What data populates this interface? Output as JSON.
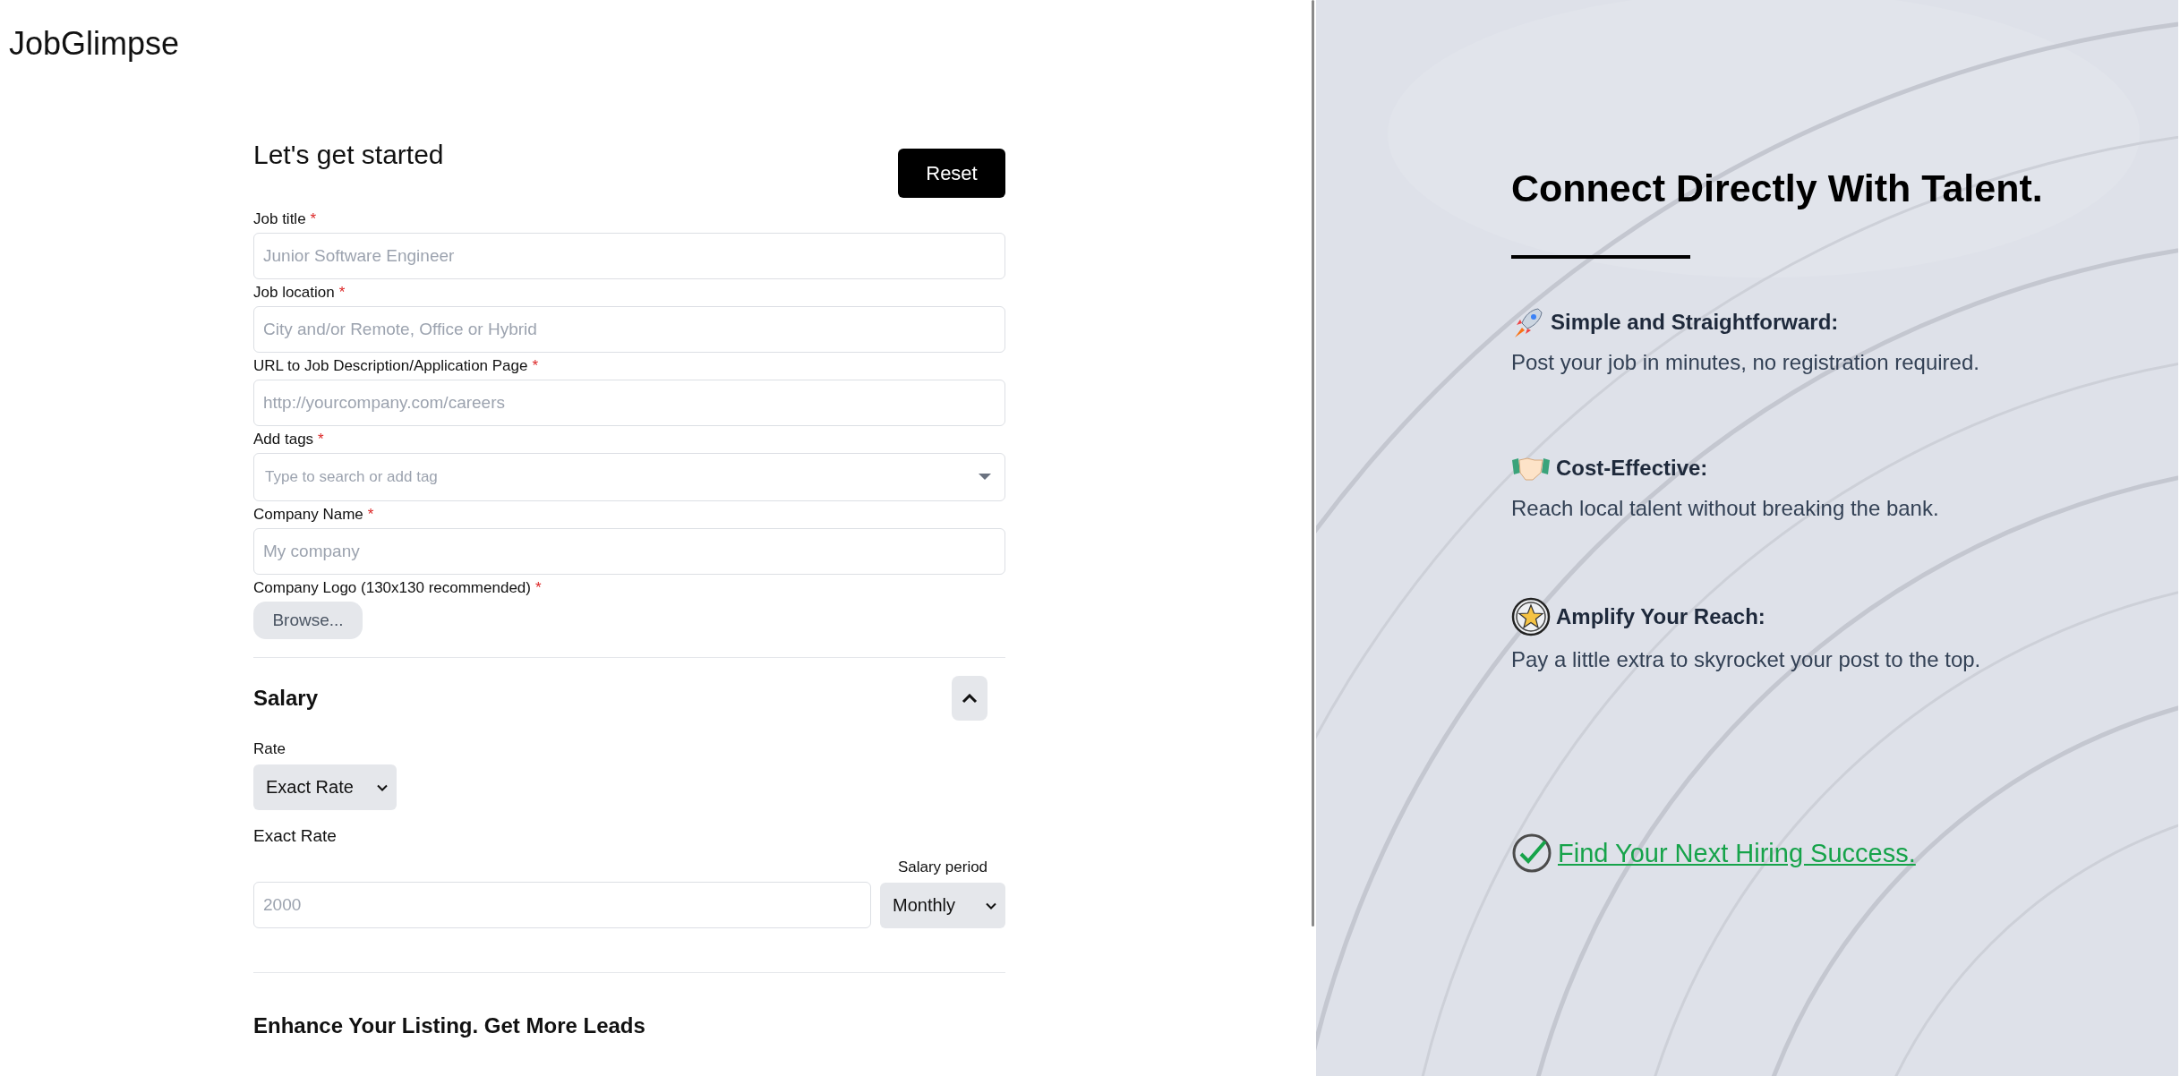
{
  "logo": "JobGlimpse",
  "form": {
    "heading": "Let's get started",
    "reset_button": "Reset",
    "required_mark": "*",
    "fields": [
      {
        "kind": "text",
        "label": "Job title",
        "required": true,
        "placeholder": "Junior Software Engineer"
      },
      {
        "kind": "text",
        "label": "Job location",
        "required": true,
        "placeholder": "City and/or Remote, Office or Hybrid"
      },
      {
        "kind": "text",
        "label": "URL to Job Description/Application Page",
        "required": true,
        "placeholder": "http://yourcompany.com/careers"
      },
      {
        "kind": "tags",
        "label": "Add tags",
        "required": true,
        "placeholder": "Type to search or add tag"
      },
      {
        "kind": "text",
        "label": "Company Name",
        "required": true,
        "placeholder": "My company"
      },
      {
        "kind": "file",
        "label": "Company Logo (130x130 recommended)",
        "required": true,
        "button": "Browse..."
      }
    ],
    "salary": {
      "title": "Salary",
      "expanded": true,
      "rate_label": "Rate",
      "rate_value": "Exact Rate",
      "exact_rate_label": "Exact Rate",
      "amount_placeholder": "2000",
      "period_label": "Salary period",
      "period_value": "Monthly"
    },
    "enhance_title": "Enhance Your Listing. Get More Leads"
  },
  "promo": {
    "heading": "Connect Directly With Talent.",
    "features": [
      {
        "kind": "rocket",
        "title": "Simple and Straightforward:",
        "text": "Post your job in minutes, no registration required."
      },
      {
        "kind": "handshake",
        "title": "Cost-Effective:",
        "text": "Reach local talent without breaking the bank."
      },
      {
        "kind": "star",
        "title": "Amplify Your Reach:",
        "text": "Pay a little extra to skyrocket your post to the top."
      }
    ],
    "link": "Find Your Next Hiring Success."
  }
}
